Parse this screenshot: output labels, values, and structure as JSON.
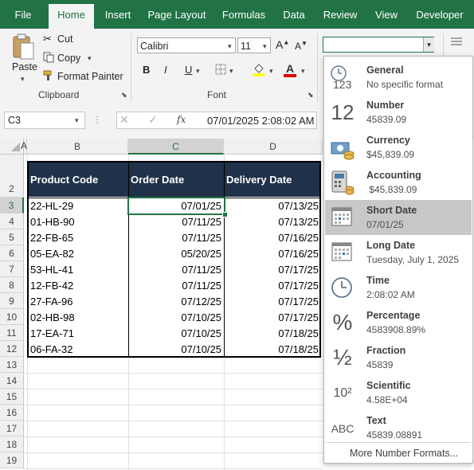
{
  "tabs": [
    {
      "label": "File",
      "active": false
    },
    {
      "label": "Home",
      "active": true
    },
    {
      "label": "Insert",
      "active": false
    },
    {
      "label": "Page Layout",
      "active": false
    },
    {
      "label": "Formulas",
      "active": false
    },
    {
      "label": "Data",
      "active": false
    },
    {
      "label": "Review",
      "active": false
    },
    {
      "label": "View",
      "active": false
    },
    {
      "label": "Developer",
      "active": false
    }
  ],
  "clipboard": {
    "paste_label": "Paste",
    "cut_label": "Cut",
    "copy_label": "Copy",
    "format_painter_label": "Format Painter",
    "group_label": "Clipboard"
  },
  "font": {
    "name": "Calibri",
    "size": "11",
    "bold": "B",
    "italic": "I",
    "underline": "U",
    "font_color_letter": "A",
    "group_label": "Font"
  },
  "number_format": {
    "current": ""
  },
  "formula_bar": {
    "name_box": "C3",
    "fx": "fx",
    "value": "07/01/2025  2:08:02 AM"
  },
  "columns": [
    "A",
    "B",
    "C",
    "D"
  ],
  "rows": [
    "2",
    "3",
    "4",
    "5",
    "6",
    "7",
    "8",
    "9",
    "10",
    "11",
    "12",
    "13",
    "14",
    "15",
    "16",
    "17",
    "18",
    "19"
  ],
  "table": {
    "headers": [
      "Product Code",
      "Order Date",
      "Delivery Date"
    ],
    "rows": [
      [
        "22-HL-29",
        "07/01/25",
        "07/13/25"
      ],
      [
        "01-HB-90",
        "07/11/25",
        "07/13/25"
      ],
      [
        "22-FB-65",
        "07/11/25",
        "07/16/25"
      ],
      [
        "05-EA-82",
        "05/20/25",
        "07/16/25"
      ],
      [
        "53-HL-41",
        "07/11/25",
        "07/17/25"
      ],
      [
        "12-FB-42",
        "07/11/25",
        "07/17/25"
      ],
      [
        "27-FA-96",
        "07/12/25",
        "07/17/25"
      ],
      [
        "02-HB-98",
        "07/10/25",
        "07/17/25"
      ],
      [
        "17-EA-71",
        "07/10/25",
        "07/18/25"
      ],
      [
        "06-FA-32",
        "07/10/25",
        "07/18/25"
      ]
    ]
  },
  "formats": [
    {
      "title": "General",
      "sample": "No specific format",
      "icon": "clock-123-icon",
      "glyph": "123"
    },
    {
      "title": "Number",
      "sample": "45839.09",
      "icon": "number-12-icon",
      "glyph": "12"
    },
    {
      "title": "Currency",
      "sample": "$45,839.09",
      "icon": "currency-icon",
      "glyph": ""
    },
    {
      "title": "Accounting",
      "sample": " $45,839.09",
      "icon": "accounting-icon",
      "glyph": ""
    },
    {
      "title": "Short Date",
      "sample": "07/01/25",
      "icon": "short-date-calendar-icon",
      "glyph": "",
      "selected": true
    },
    {
      "title": "Long Date",
      "sample": "Tuesday, July 1, 2025",
      "icon": "long-date-calendar-icon",
      "glyph": ""
    },
    {
      "title": "Time",
      "sample": "2:08:02 AM",
      "icon": "time-clock-icon",
      "glyph": ""
    },
    {
      "title": "Percentage",
      "sample": "4583908.89%",
      "icon": "percent-icon",
      "glyph": "%"
    },
    {
      "title": "Fraction",
      "sample": "45839",
      "icon": "fraction-icon",
      "glyph": "½"
    },
    {
      "title": "Scientific",
      "sample": "4.58E+04",
      "icon": "scientific-icon",
      "glyph": "10²"
    },
    {
      "title": "Text",
      "sample": "45839.08891",
      "icon": "text-abc-icon",
      "glyph": "ABC"
    }
  ],
  "more_formats_label": "More Number Formats...",
  "colors": {
    "ribbon_green": "#217346",
    "header_fill": "#1f3249",
    "selected_format": "#c8c8c8"
  }
}
